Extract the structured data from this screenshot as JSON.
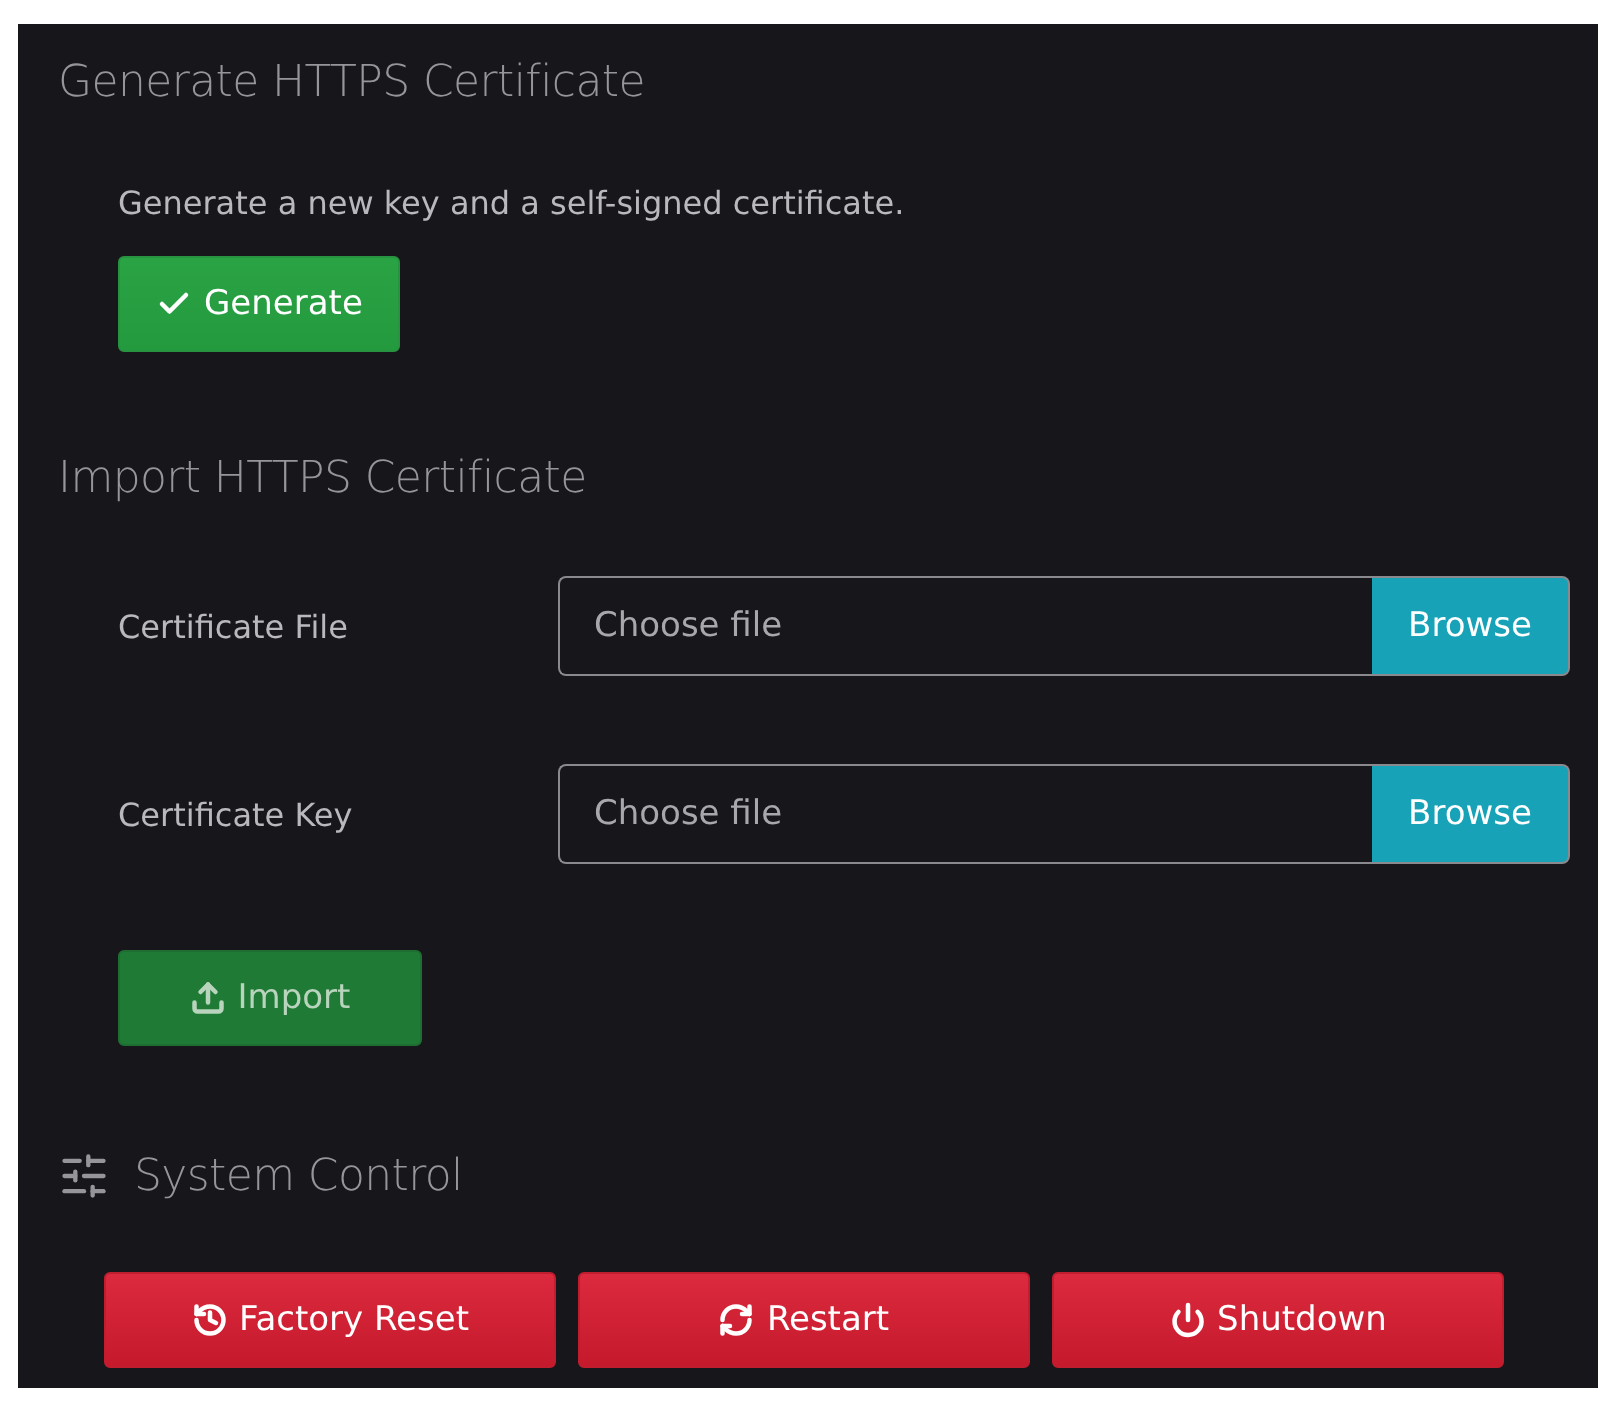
{
  "generate_section": {
    "title": "Generate HTTPS Certificate",
    "description": "Generate a new key and a self-signed certificate.",
    "button": {
      "label": "Generate",
      "kind": "confirm",
      "disabled": false
    }
  },
  "import_section": {
    "title": "Import HTTPS Certificate",
    "fields": [
      {
        "label": "Certificate File",
        "placeholder": "Choose file",
        "button": "Browse"
      },
      {
        "label": "Certificate Key",
        "placeholder": "Choose file",
        "button": "Browse"
      }
    ],
    "button": {
      "label": "Import",
      "kind": "upload",
      "disabled": true
    }
  },
  "system_control": {
    "title": "System Control",
    "buttons": [
      {
        "label": "Factory Reset",
        "kind": "reset"
      },
      {
        "label": "Restart",
        "kind": "restart"
      },
      {
        "label": "Shutdown",
        "kind": "shutdown"
      }
    ]
  }
}
